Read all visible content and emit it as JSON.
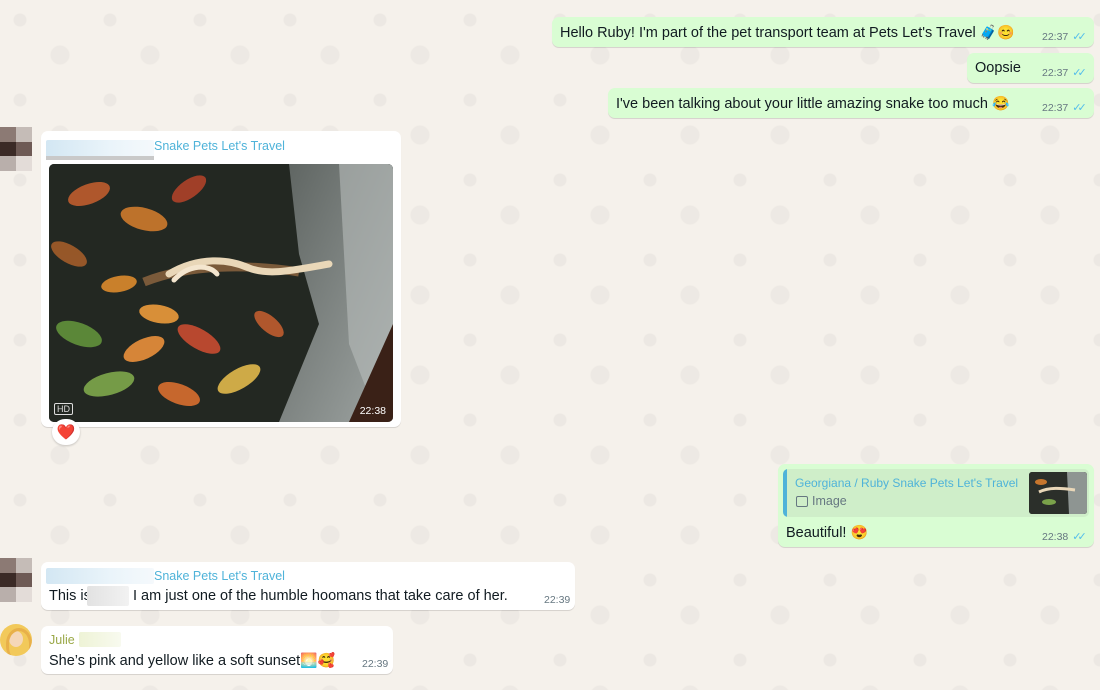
{
  "messages": {
    "m1": {
      "text": "Hello Ruby! I'm part of the pet transport team at Pets Let's Travel",
      "emoji": "🧳😊",
      "time": "22:37"
    },
    "m2": {
      "text": "Oopsie",
      "time": "22:37"
    },
    "m3": {
      "text": "I've been talking about your little amazing snake too much",
      "emoji": "😂",
      "time": "22:37"
    },
    "m4": {
      "sender": "Snake Pets Let's Travel",
      "hd": "HD",
      "time": "22:38",
      "reaction": "❤️"
    },
    "m5": {
      "quote_sender": "Georgiana / Ruby Snake Pets Let's Travel",
      "quote_label": "Image",
      "text": "Beautiful!",
      "emoji": "😍",
      "time": "22:38"
    },
    "m6": {
      "sender": "Snake Pets Let's Travel",
      "text_a": "This is",
      "text_b": "I am just one of the humble hoomans that take care of her.",
      "time": "22:39"
    },
    "m7": {
      "sender": "Julie",
      "text": "She’s pink and yellow like a soft sunset",
      "emoji": "🌅🥰",
      "time": "22:39"
    }
  },
  "colors": {
    "outgoing": "#d9fdd3",
    "incoming": "#ffffff",
    "ticks": "#53bdeb",
    "sender": "#4fb3d9"
  },
  "icons": [
    "double-check-icon",
    "image-icon",
    "heart-reaction-icon",
    "hd-badge-icon"
  ]
}
